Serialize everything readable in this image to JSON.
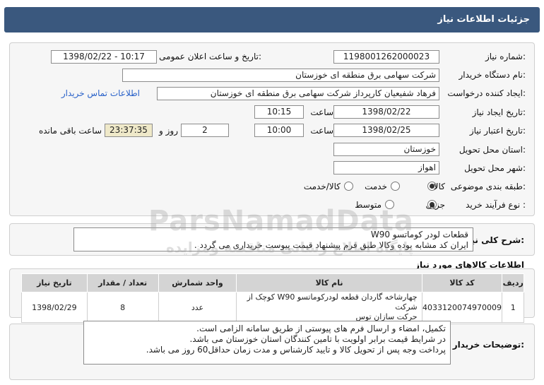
{
  "header": {
    "title": "جزئیات اطلاعات نیاز"
  },
  "form": {
    "need_number_label": "شماره نیاز:",
    "need_number": "1198001262000023",
    "announce_label": "تاریخ و ساعت اعلان عمومی:",
    "announce_value": "1398/02/22 - 10:17",
    "buyer_org_label": "نام دستگاه خریدار:",
    "buyer_org": "شرکت سهامی برق منطقه ای خوزستان",
    "requester_label": "ایجاد کننده درخواست:",
    "requester": "فرهاد شفیعیان کارپرداز شرکت سهامی برق منطقه ای خوزستان",
    "contact_link": "اطلاعات تماس خریدار",
    "created_label": "تاریخ ایجاد نیاز:",
    "created_date": "1398/02/22",
    "time_label": "ساعت",
    "created_time": "10:15",
    "validity_label": "تاریخ اعتبار نیاز:",
    "validity_date": "1398/02/25",
    "validity_time": "10:00",
    "days_value": "2",
    "days_label": "روز و",
    "remaining_time": "23:37:35",
    "remaining_label": "ساعت باقی مانده",
    "province_label": "استان محل تحویل:",
    "province": "خوزستان",
    "city_label": "شهر محل تحویل:",
    "city": "اهواز",
    "category_label": "طبقه بندی موضوعی:",
    "category_options": [
      "کالا",
      "خدمت",
      "کالا/خدمت"
    ],
    "category_selected": "کالا",
    "process_label": "نوع فرآیند خرید :",
    "process_options": [
      "جزیی",
      "متوسط"
    ],
    "process_selected": "جزیی"
  },
  "summary": {
    "label": "شرح کلی نیاز:",
    "line1": "قطعات لودر کوماتسو W90",
    "line2": "ایران کد مشابه بوده وکالا طبق فرم پیشنهاد قیمت پیوست خریداری می گردد ."
  },
  "items_section": {
    "title": "اطلاعات کالاهای مورد نیاز",
    "columns": [
      "ردیف",
      "کد کالا",
      "نام کالا",
      "واحد شمارش",
      "تعداد / مقدار",
      "تاریخ نیاز"
    ],
    "rows": [
      {
        "index": "1",
        "code": "4033120074970009",
        "name_line1": "چهارشاخه گاردان قطعه لودرکوماتسو W90 کوچک از شرکت",
        "name_line2": "حرکت سازان توس",
        "unit": "عدد",
        "quantity": "8",
        "date": "1398/02/29"
      }
    ]
  },
  "buyer_notes": {
    "label": "توضیحات خریدار:",
    "line1": "تکمیل، امضاء و ارسال فرم های پیوستی از طریق سامانه الزامی است.",
    "line2": "در شرایط  قیمت برابر اولویت با تامین کنندگان استان خوزستان می باشد.",
    "line3": "پرداخت وجه پس از تحویل کالا و تایید کارشناس و مدت زمان حداقل60 روز می باشد."
  },
  "watermark": {
    "text": "ParsNamadData",
    "sub": "پایگاه اطلاع رسانی مناقصه ومزایده"
  }
}
